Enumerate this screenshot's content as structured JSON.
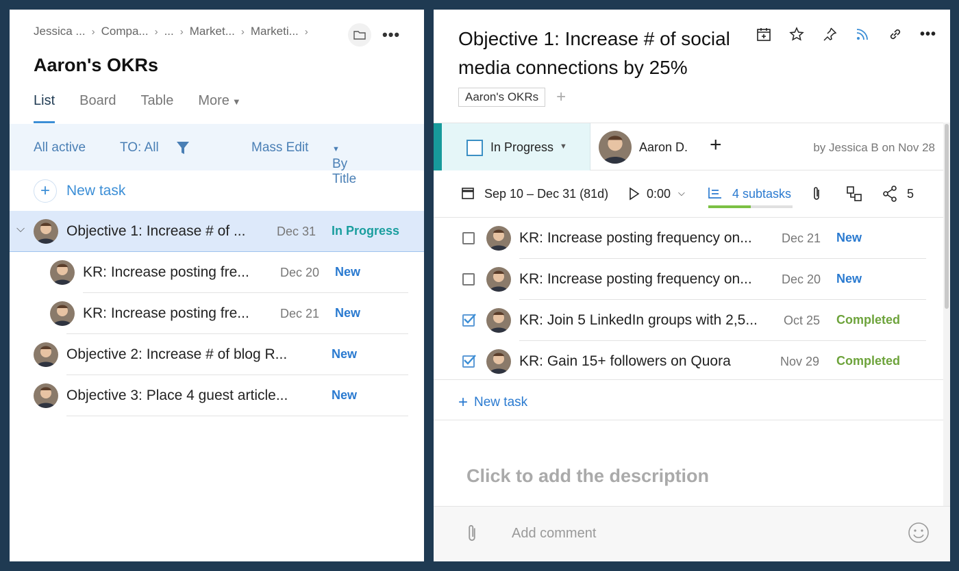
{
  "left": {
    "breadcrumbs": [
      "Jessica ...",
      "Compa...",
      "...",
      "Market...",
      "Marketi..."
    ],
    "title": "Aaron's OKRs",
    "tabs": [
      {
        "label": "List",
        "active": true
      },
      {
        "label": "Board",
        "active": false
      },
      {
        "label": "Table",
        "active": false
      },
      {
        "label": "More",
        "active": false
      }
    ],
    "toolbar": {
      "all_active": "All active",
      "to_all": "TO: All",
      "mass_edit": "Mass Edit",
      "by_title": "By Title"
    },
    "new_task": "New task",
    "tasks": [
      {
        "title": "Objective 1: Increase # of ...",
        "date": "Dec 31",
        "status": "In Progress",
        "level": 0,
        "selected": true
      },
      {
        "title": "KR: Increase posting fre...",
        "date": "Dec 20",
        "status": "New",
        "level": 1
      },
      {
        "title": "KR: Increase posting fre...",
        "date": "Dec 21",
        "status": "New",
        "level": 1
      },
      {
        "title": "Objective 2: Increase # of blog R...",
        "date": "",
        "status": "New",
        "level": 0
      },
      {
        "title": "Objective 3: Place 4 guest article...",
        "date": "",
        "status": "New",
        "level": 0
      }
    ]
  },
  "right": {
    "title": "Objective 1: Increase # of social media connections by 25%",
    "tag": "Aaron's OKRs",
    "status": "In Progress",
    "assignee": "Aaron D.",
    "author": "by Jessica B on Nov 28",
    "dates": "Sep 10 – Dec 31 (81d)",
    "timer": "0:00",
    "subtasks_label": "4 subtasks",
    "subtasks_progress": 0.5,
    "share_count": "5",
    "subtasks": [
      {
        "title": "KR: Increase posting frequency on...",
        "date": "Dec 21",
        "status": "New",
        "checked": false
      },
      {
        "title": "KR: Increase posting frequency on...",
        "date": "Dec 20",
        "status": "New",
        "checked": false
      },
      {
        "title": "KR: Join 5 LinkedIn groups with 2,5...",
        "date": "Oct 25",
        "status": "Completed",
        "checked": true
      },
      {
        "title": "KR: Gain 15+ followers on Quora",
        "date": "Nov 29",
        "status": "Completed",
        "checked": true
      }
    ],
    "new_task": "New task",
    "description_placeholder": "Click to add the description",
    "comment_placeholder": "Add comment"
  },
  "colors": {
    "background": "#1f3a52",
    "accent": "#2a7ad0",
    "in_progress": "#1a9e9e",
    "completed": "#6da33b"
  }
}
